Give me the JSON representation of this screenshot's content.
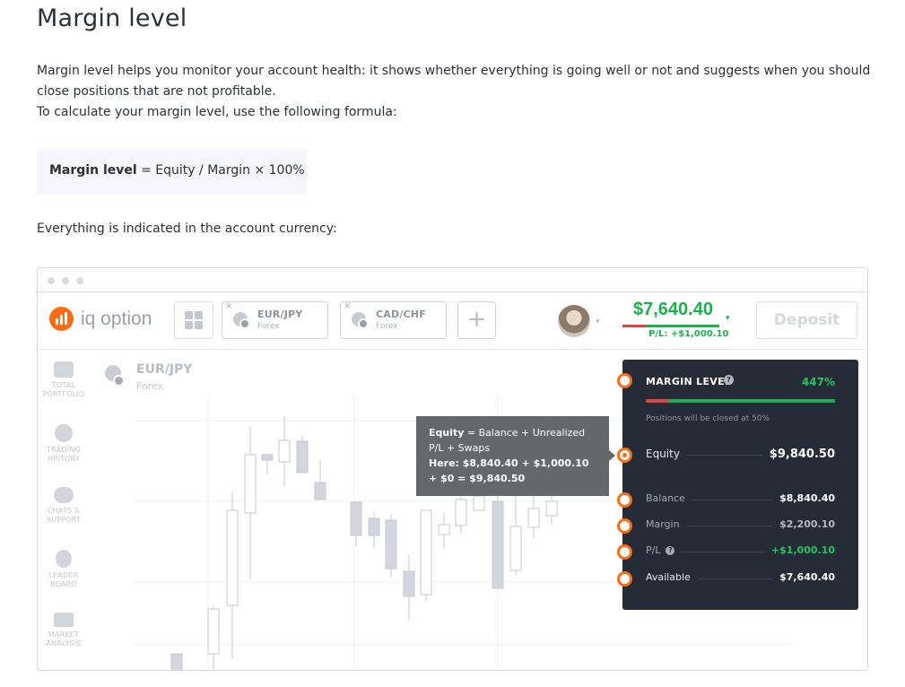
{
  "article": {
    "title": "Margin level",
    "intro_line1": "Margin level helps you monitor your account health: it shows whether everything is going well or not and suggests when you should close positions that are not profitable.",
    "intro_line2": "To calculate your margin level, use the following formula:",
    "formula_label": "Margin level",
    "formula_rest": " = Equity / Margin × 100%",
    "note": "Everything is indicated in the account currency:"
  },
  "app": {
    "logo_text": "iq option",
    "tabs": [
      {
        "name": "EUR/JPY",
        "sub": "Forex",
        "close": "×"
      },
      {
        "name": "CAD/CHF",
        "sub": "Forex",
        "close": "×"
      }
    ],
    "plus": "+",
    "balance": "$7,640.40",
    "pl": "P/L: +$1,000.10",
    "deposit": "Deposit",
    "caret": "▾"
  },
  "sidebar": {
    "items": [
      {
        "label_1": "TOTAL",
        "label_2": "PORTFOLIO",
        "icon": "briefcase-icon"
      },
      {
        "label_1": "TRADING",
        "label_2": "HISTORY",
        "icon": "history-icon"
      },
      {
        "label_1": "CHATS &",
        "label_2": "SUPPORT",
        "icon": "chat-icon"
      },
      {
        "label_1": "LEADER",
        "label_2": "BOARD",
        "icon": "medal-icon"
      },
      {
        "label_1": "MARKET",
        "label_2": "ANALYSIS",
        "icon": "newspaper-icon"
      }
    ]
  },
  "asset": {
    "name": "EUR/JPY",
    "sub": "Forex"
  },
  "tooltip": {
    "bold": "Equity",
    "line1_rest": " = Balance + Unrealized P/L + Swaps",
    "line2": "Here: $8,840.40 + $1,000.10 + $0 = $9,840.50"
  },
  "margin_panel": {
    "title": "MARGIN LEVEL",
    "help": "?",
    "value": "447%",
    "note": "Positions will be closed at 50%",
    "rows": [
      {
        "label": "Equity",
        "value": "$9,840.50"
      },
      {
        "label": "Balance",
        "value": "$8,840.40"
      },
      {
        "label": "Margin",
        "value": "$2,200.10"
      },
      {
        "label": "P/L",
        "value": "+$1,000.10"
      },
      {
        "label": "Available",
        "value": "$7,640.40"
      }
    ]
  },
  "colors": {
    "accent": "#ff6a13",
    "green": "#19b34c",
    "red": "#e0443a",
    "panel": "#252b37"
  }
}
